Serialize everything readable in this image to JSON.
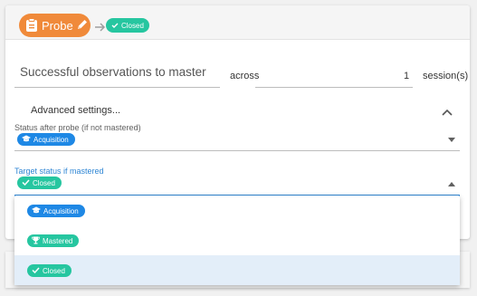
{
  "header": {
    "probe_label": "Probe",
    "next_status": "Closed"
  },
  "criteria": {
    "label": "Successful observations to master",
    "across": "across",
    "count": "1",
    "sessions": "session(s)"
  },
  "advanced": {
    "title": "Advanced settings..."
  },
  "status_after": {
    "label": "Status after probe (if not mastered)",
    "value": "Acquisition"
  },
  "target_status": {
    "label": "Target status if mastered",
    "value": "Closed"
  },
  "menu": {
    "options": [
      "Acquisition",
      "Mastered",
      "Closed"
    ],
    "selected": "Closed"
  },
  "colors": {
    "probe": "#f08a3a",
    "acquisition": "#1e88e5",
    "closed": "#26c6a0",
    "mastered": "#26c6a0",
    "focus": "#2f86d4"
  }
}
